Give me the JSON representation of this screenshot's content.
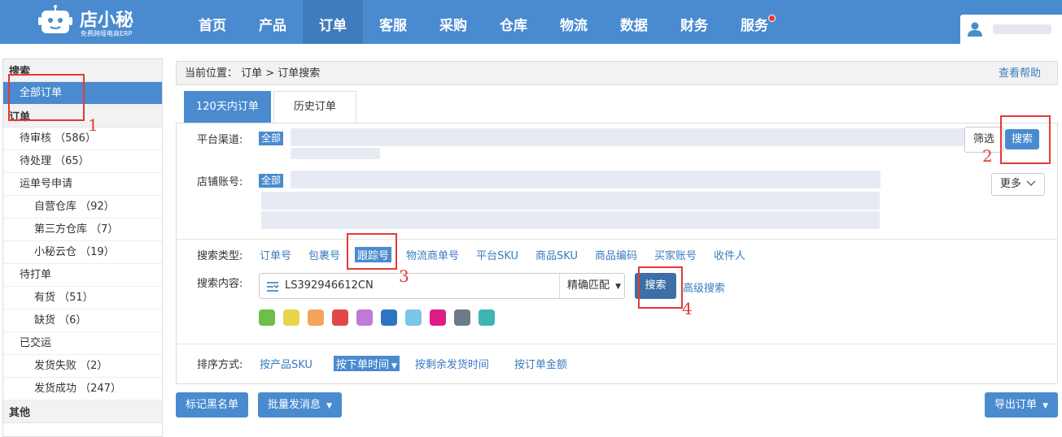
{
  "header": {
    "logo_title": "店小秘",
    "logo_sub": "免费跨境电商ERP",
    "nav": [
      {
        "label": "首页",
        "active": false
      },
      {
        "label": "产品",
        "active": false
      },
      {
        "label": "订单",
        "active": true
      },
      {
        "label": "客服",
        "active": false
      },
      {
        "label": "采购",
        "active": false
      },
      {
        "label": "仓库",
        "active": false
      },
      {
        "label": "物流",
        "active": false
      },
      {
        "label": "数据",
        "active": false
      },
      {
        "label": "财务",
        "active": false
      },
      {
        "label": "服务",
        "active": false,
        "notification_dot": true
      }
    ]
  },
  "sidebar": {
    "search_heading": "搜索",
    "all_orders": "全部订单",
    "orders_heading": "订单",
    "items": [
      {
        "label": "待审核 （586）",
        "sub": false
      },
      {
        "label": "待处理 （65）",
        "sub": false
      },
      {
        "label": "运单号申请",
        "sub": false
      },
      {
        "label": "自营仓库 （92）",
        "sub": true
      },
      {
        "label": "第三方仓库 （7）",
        "sub": true
      },
      {
        "label": "小秘云仓 （19）",
        "sub": true
      },
      {
        "label": "待打单",
        "sub": false
      },
      {
        "label": "有货 （51）",
        "sub": true
      },
      {
        "label": "缺货 （6）",
        "sub": true
      },
      {
        "label": "已交运",
        "sub": false
      },
      {
        "label": "发货失败 （2）",
        "sub": true
      },
      {
        "label": "发货成功 （247）",
        "sub": true
      }
    ],
    "other_heading": "其他"
  },
  "main": {
    "breadcrumb": "当前位置： 订单 > 订单搜索",
    "help_link": "查看帮助",
    "tabs": [
      "120天内订单",
      "历史订单"
    ],
    "platform_label": "平台渠道:",
    "shop_label": "店铺账号:",
    "all_tag": "全部",
    "filter_button": "筛选",
    "search_button": "搜索",
    "more_button": "更多",
    "search_type_label": "搜索类型:",
    "search_types": [
      "订单号",
      "包裹号",
      "跟踪号",
      "物流商单号",
      "平台SKU",
      "商品SKU",
      "商品编码",
      "买家账号",
      "收件人"
    ],
    "active_search_type": "跟踪号",
    "search_content_label": "搜索内容:",
    "search_value": "LS392946612CN",
    "match_mode": "精确匹配",
    "search_go_button": "搜索",
    "advanced_search": "高级搜索",
    "color_flags": [
      "#6cc04a",
      "#e8d44d",
      "#f4a55b",
      "#e04848",
      "#c27ad9",
      "#2e74c2",
      "#7cc6ea",
      "#dd1c85",
      "#6c7b87",
      "#3cb6b0"
    ],
    "sort_label": "排序方式:",
    "sort_options": [
      "按产品SKU",
      "按下单时间",
      "按剩余发货时间",
      "按订单金额"
    ],
    "active_sort": "按下单时间",
    "bottom_buttons": {
      "blacklist": "标记黑名单",
      "bulk_message": "批量发消息",
      "export": "导出订单"
    }
  },
  "annotations": [
    "1",
    "2",
    "3",
    "4"
  ]
}
